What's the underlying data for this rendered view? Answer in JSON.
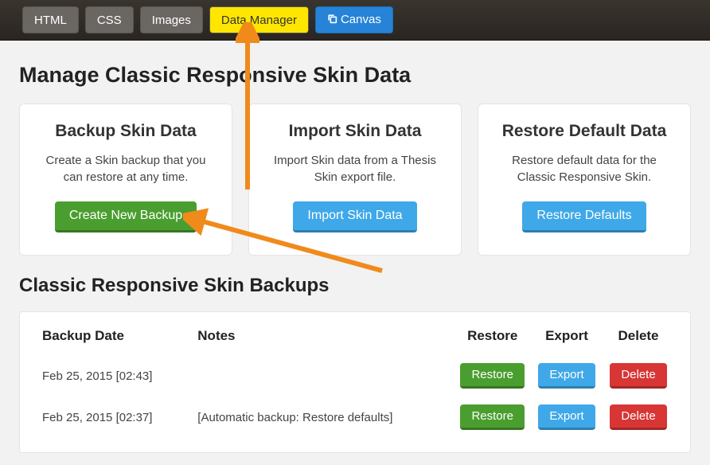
{
  "topbar": {
    "tabs": [
      {
        "label": "HTML"
      },
      {
        "label": "CSS"
      },
      {
        "label": "Images"
      },
      {
        "label": "Data Manager"
      },
      {
        "label": "Canvas"
      }
    ]
  },
  "heading_main": "Manage Classic Responsive Skin Data",
  "cards": {
    "backup": {
      "title": "Backup Skin Data",
      "text": "Create a Skin backup that you can restore at any time.",
      "button": "Create New Backup"
    },
    "import": {
      "title": "Import Skin Data",
      "text": "Import Skin data from a Thesis Skin export file.",
      "button": "Import Skin Data"
    },
    "restore": {
      "title": "Restore Default Data",
      "text": "Restore default data for the Classic Responsive Skin.",
      "button": "Restore Defaults"
    }
  },
  "heading_backups": "Classic Responsive Skin Backups",
  "table": {
    "headers": {
      "date": "Backup Date",
      "notes": "Notes",
      "restore": "Restore",
      "export": "Export",
      "delete": "Delete"
    }
  },
  "backups": [
    {
      "date": "Feb 25, 2015 [02:43]",
      "notes": "",
      "restore_label": "Restore",
      "export_label": "Export",
      "delete_label": "Delete"
    },
    {
      "date": "Feb 25, 2015 [02:37]",
      "notes": "[Automatic backup: Restore defaults]",
      "restore_label": "Restore",
      "export_label": "Export",
      "delete_label": "Delete"
    }
  ]
}
